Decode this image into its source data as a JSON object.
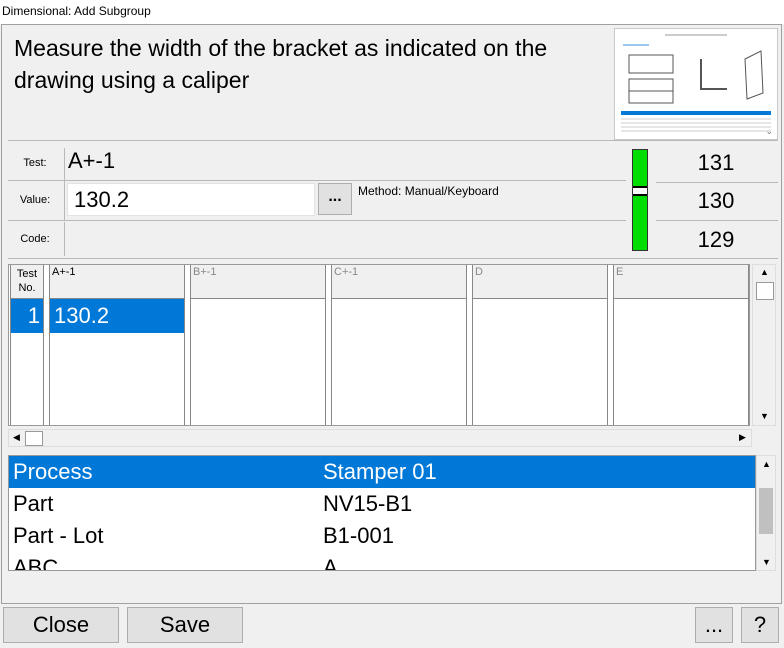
{
  "window": {
    "title": "Dimensional: Add Subgroup"
  },
  "instruction": {
    "text": "Measure the width of the bracket as indicated on the drawing using a caliper"
  },
  "thumbnail": {
    "icon": "drawing-thumbnail-icon"
  },
  "form": {
    "test_label": "Test:",
    "test_value": "A+-1",
    "value_label": "Value:",
    "value_input": "130.2",
    "browse_label": "...",
    "method_text": "Method: Manual/Keyboard",
    "code_label": "Code:"
  },
  "gauge": {
    "colors": {
      "ok": "#00dd00"
    }
  },
  "limits": {
    "upper": "131",
    "target": "130",
    "lower": "129"
  },
  "grid": {
    "testno_header": "Test No.",
    "columns": [
      "A+-1",
      "B+-1",
      "C+-1",
      "D",
      "E"
    ],
    "rows": [
      {
        "no": "1",
        "values": [
          "130.2",
          "",
          "",
          "",
          ""
        ]
      }
    ]
  },
  "info": {
    "rows": [
      {
        "key": "Process",
        "value": "Stamper 01"
      },
      {
        "key": "Part",
        "value": "NV15-B1"
      },
      {
        "key": "Part - Lot",
        "value": "B1-001"
      },
      {
        "key": "ABC",
        "value": "A"
      }
    ]
  },
  "buttons": {
    "close": "Close",
    "save": "Save",
    "more": "...",
    "help": "?"
  },
  "colors": {
    "selection": "#0078d7"
  }
}
